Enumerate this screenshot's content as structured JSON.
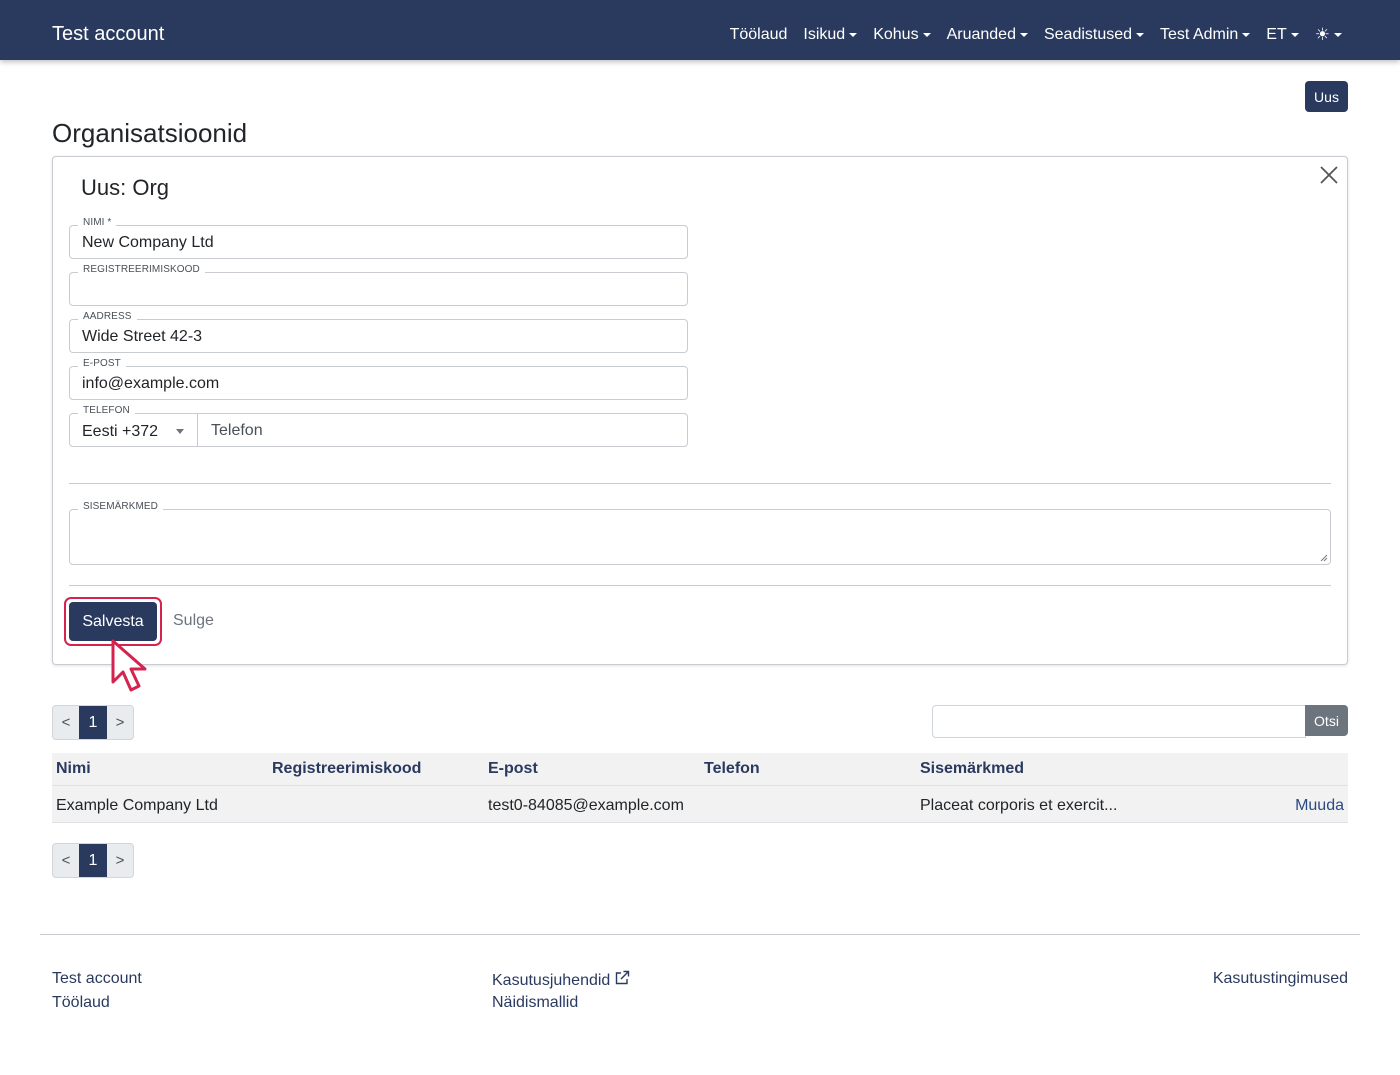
{
  "navbar": {
    "brand": "Test account",
    "items": [
      {
        "label": "Töölaud",
        "dropdown": false
      },
      {
        "label": "Isikud",
        "dropdown": true
      },
      {
        "label": "Kohus",
        "dropdown": true
      },
      {
        "label": "Aruanded",
        "dropdown": true
      },
      {
        "label": "Seadistused",
        "dropdown": true
      },
      {
        "label": "Test Admin",
        "dropdown": true
      },
      {
        "label": "ET",
        "dropdown": true
      }
    ],
    "theme_icon": "sun-icon",
    "theme_glyph": "☀"
  },
  "header": {
    "new_button": "Uus",
    "title": "Organisatsioonid"
  },
  "form": {
    "title": "Uus: Org",
    "close_icon": "close-icon",
    "fields": {
      "name": {
        "label": "Nimi *",
        "value": "New Company Ltd"
      },
      "regcode": {
        "label": "Registreerimiskood",
        "value": ""
      },
      "address": {
        "label": "Aadress",
        "value": "Wide Street 42-3"
      },
      "email": {
        "label": "E-post",
        "value": "info@example.com"
      },
      "phone": {
        "label": "Telefon",
        "country": "Eesti +372",
        "value": "",
        "placeholder": "Telefon"
      },
      "notes": {
        "label": "Sisemärkmed",
        "value": ""
      }
    },
    "save_button": "Salvesta",
    "close_button": "Sulge"
  },
  "pagination": {
    "prev": "<",
    "current": "1",
    "next": ">"
  },
  "search": {
    "value": "",
    "button": "Otsi"
  },
  "table": {
    "headers": [
      "Nimi",
      "Registreerimiskood",
      "E-post",
      "Telefon",
      "Sisemärkmed"
    ],
    "rows": [
      {
        "name": "Example Company Ltd",
        "regcode": "",
        "email": "test0-84085@example.com",
        "phone": "",
        "notes": "Placeat corporis et exercit...",
        "action": "Muuda"
      }
    ]
  },
  "footer": {
    "col1": [
      "Test account",
      "Töölaud"
    ],
    "col2": [
      "Kasutusjuhendid",
      "Näidismallid"
    ],
    "col3": [
      "Kasutustingimused"
    ],
    "external_icon": "external-link-icon"
  },
  "colors": {
    "primary": "#2a3a5f",
    "highlight": "#d4234f",
    "secondary": "#6c757d"
  }
}
